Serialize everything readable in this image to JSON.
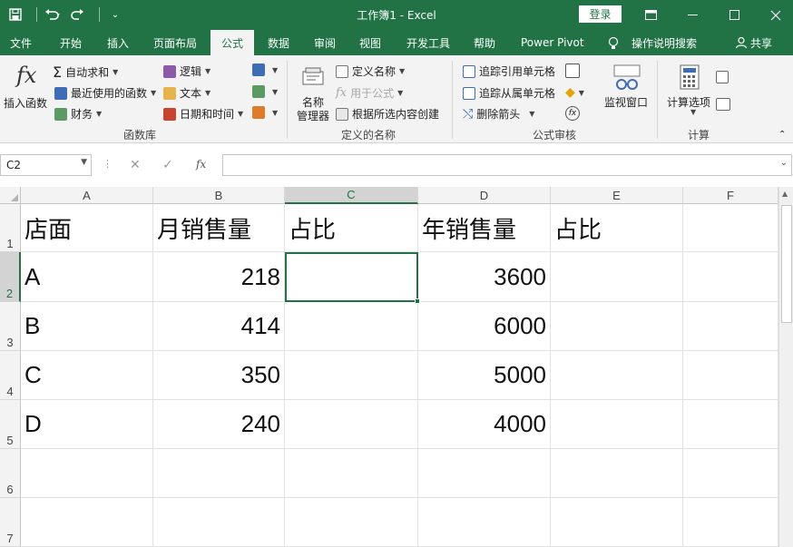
{
  "titlebar": {
    "title": "工作簿1 - Excel",
    "login_label": "登录",
    "save_icon": "save-icon",
    "undo_icon": "undo-icon",
    "redo_icon": "redo-icon"
  },
  "tabs": [
    "文件",
    "开始",
    "插入",
    "页面布局",
    "公式",
    "数据",
    "审阅",
    "视图",
    "开发工具",
    "帮助",
    "Power Pivot",
    "操作说明搜索",
    "共享"
  ],
  "active_tab": "公式",
  "ribbon": {
    "insert_function": "插入函数",
    "autosum": "自动求和",
    "recent": "最近使用的函数",
    "finance": "财务",
    "logic": "逻辑",
    "text": "文本",
    "datetime": "日期和时间",
    "group_library": "函数库",
    "name_manager_1": "名称",
    "name_manager_2": "管理器",
    "define_name": "定义名称",
    "use_in_formula": "用于公式",
    "create_from_selection": "根据所选内容创建",
    "group_names": "定义的名称",
    "trace_precedents": "追踪引用单元格",
    "trace_dependents": "追踪从属单元格",
    "remove_arrows": "删除箭头",
    "watch_window": "监视窗口",
    "group_audit": "公式审核",
    "calc_options": "计算选项",
    "group_calc": "计算"
  },
  "formula_bar": {
    "name_box": "C2",
    "fx": "fx",
    "formula": ""
  },
  "sheet": {
    "columns": [
      "A",
      "B",
      "C",
      "D",
      "E",
      "F"
    ],
    "rows": [
      "1",
      "2",
      "3",
      "4",
      "5",
      "6",
      "7"
    ],
    "selected_cell": "C2",
    "headers": [
      "店面",
      "月销售量",
      "占比",
      "年销售量",
      "占比"
    ],
    "data": [
      {
        "store": "A",
        "monthly": "218",
        "yearly": "3600"
      },
      {
        "store": "B",
        "monthly": "414",
        "yearly": "6000"
      },
      {
        "store": "C",
        "monthly": "350",
        "yearly": "5000"
      },
      {
        "store": "D",
        "monthly": "240",
        "yearly": "4000"
      }
    ]
  },
  "colors": {
    "brand": "#217346",
    "ribbon_bg": "#f3f3f3"
  }
}
